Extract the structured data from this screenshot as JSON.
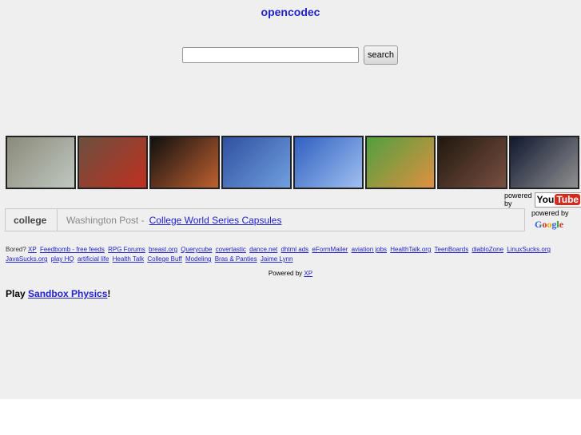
{
  "header": {
    "title": "opencodec"
  },
  "search": {
    "value": "",
    "button_label": "search"
  },
  "thumbnails": [
    {
      "colors": [
        "#8a8a7a",
        "#c0c8c0"
      ]
    },
    {
      "colors": [
        "#6a5040",
        "#c03020"
      ]
    },
    {
      "colors": [
        "#101010",
        "#c06030"
      ]
    },
    {
      "colors": [
        "#3050a0",
        "#70a0e0"
      ]
    },
    {
      "colors": [
        "#3060c0",
        "#a0c0f0"
      ]
    },
    {
      "colors": [
        "#50a040",
        "#e09040"
      ]
    },
    {
      "colors": [
        "#201810",
        "#7a5040"
      ]
    },
    {
      "colors": [
        "#101830",
        "#909090"
      ]
    }
  ],
  "youtube": {
    "powered_by": "powered by",
    "logo_you": "You",
    "logo_tube": "Tube"
  },
  "news": {
    "keyword": "college",
    "source": "Washington Post -",
    "headline": "College World Series Capsules"
  },
  "google": {
    "powered_by": "powered by",
    "logo": "Google"
  },
  "links": {
    "prefix": "Bored?",
    "items": [
      "XP",
      "Feedbomb - free feeds",
      "RPG Forums",
      "breast.org",
      "Querycube",
      "covertastic",
      "dance.net",
      "dhtml ads",
      "eFormMailer",
      "aviation jobs",
      "HealthTalk.org",
      "TeenBoards",
      "diabloZone",
      "LinuxSucks.org",
      "JavaSucks.org",
      "play HQ",
      "artificial life",
      "Health Talk",
      "College Buff",
      "Modeling",
      "Bras & Panties",
      "Jaime Lynn"
    ]
  },
  "footer": {
    "powered_by": "Powered by",
    "powered_link": "XP",
    "play_prefix": "Play",
    "play_link": "Sandbox Physics",
    "play_suffix": "!"
  }
}
